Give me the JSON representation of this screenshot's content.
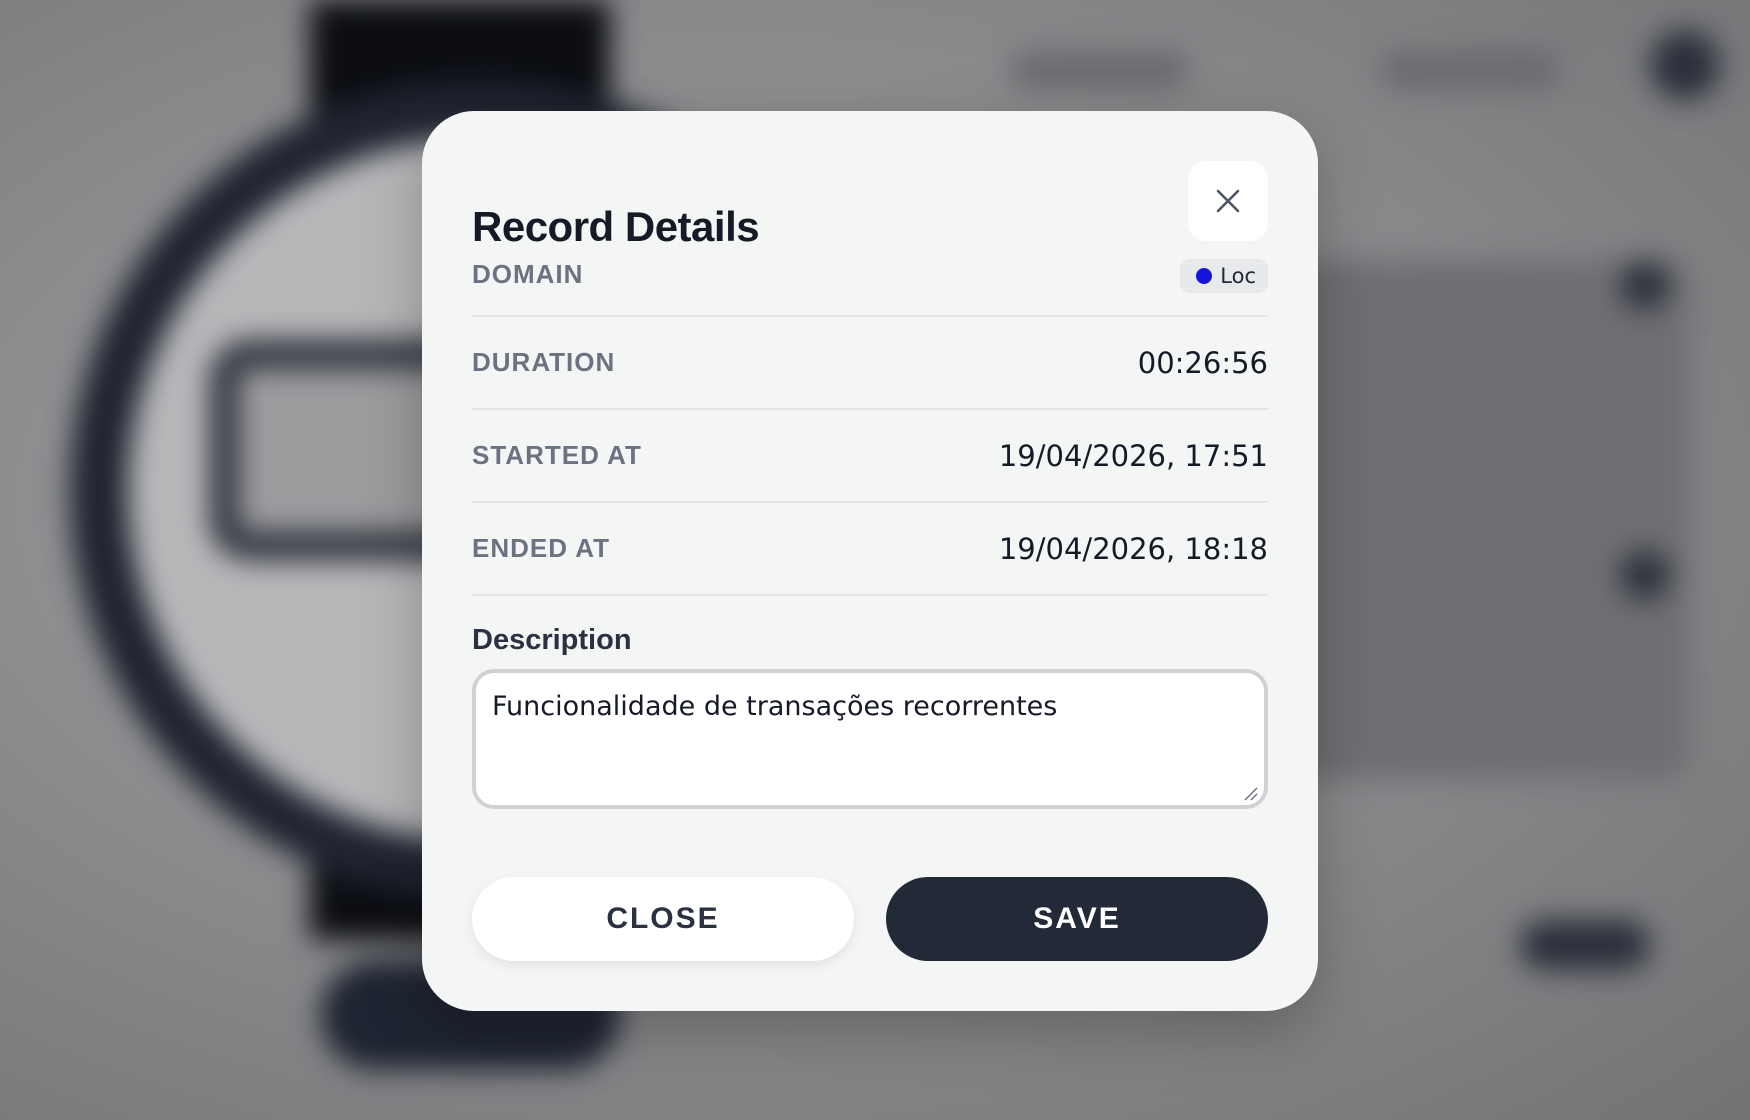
{
  "modal": {
    "title": "Record Details",
    "fields": [
      {
        "label": "DOMAIN",
        "badge": {
          "text": "Loc",
          "color": "#1414d6"
        }
      },
      {
        "label": "DURATION",
        "value": "00:26:56"
      },
      {
        "label": "STARTED AT",
        "value": "19/04/2026, 17:51"
      },
      {
        "label": "ENDED AT",
        "value": "19/04/2026, 18:18"
      }
    ],
    "description": {
      "label": "Description",
      "value": "Funcionalidade de transações recorrentes"
    },
    "buttons": {
      "close": "CLOSE",
      "save": "SAVE"
    }
  },
  "icons": {
    "close": "close-icon",
    "resize": "resize-grip-icon"
  },
  "colors": {
    "primary_button": "#222937",
    "badge_dot": "#1414d6",
    "modal_bg": "#f4f5f5"
  }
}
